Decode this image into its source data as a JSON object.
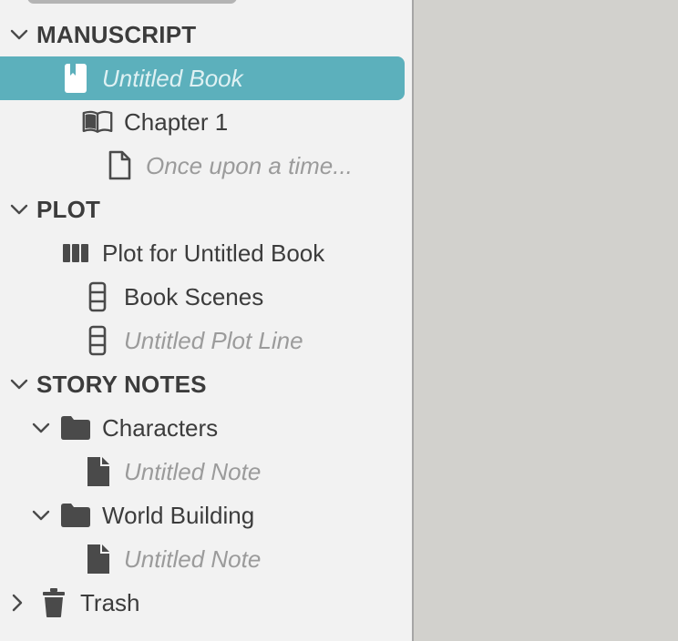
{
  "sidebar": {
    "manuscript": {
      "header": "MANUSCRIPT",
      "book": "Untitled Book",
      "chapter": "Chapter 1",
      "scene": "Once upon a time..."
    },
    "plot": {
      "header": "PLOT",
      "grid": "Plot for Untitled Book",
      "line1": "Book Scenes",
      "line2": "Untitled Plot Line"
    },
    "notes": {
      "header": "STORY NOTES",
      "folder1": "Characters",
      "note1": "Untitled Note",
      "folder2": "World Building",
      "note2": "Untitled Note"
    },
    "trash": "Trash"
  },
  "colors": {
    "selection": "#5cb0bc",
    "sidebar_bg": "#f2f2f2",
    "editor_bg": "#d2d1cd",
    "icon": "#4a4a4a",
    "muted_text": "#9b9b9b"
  }
}
